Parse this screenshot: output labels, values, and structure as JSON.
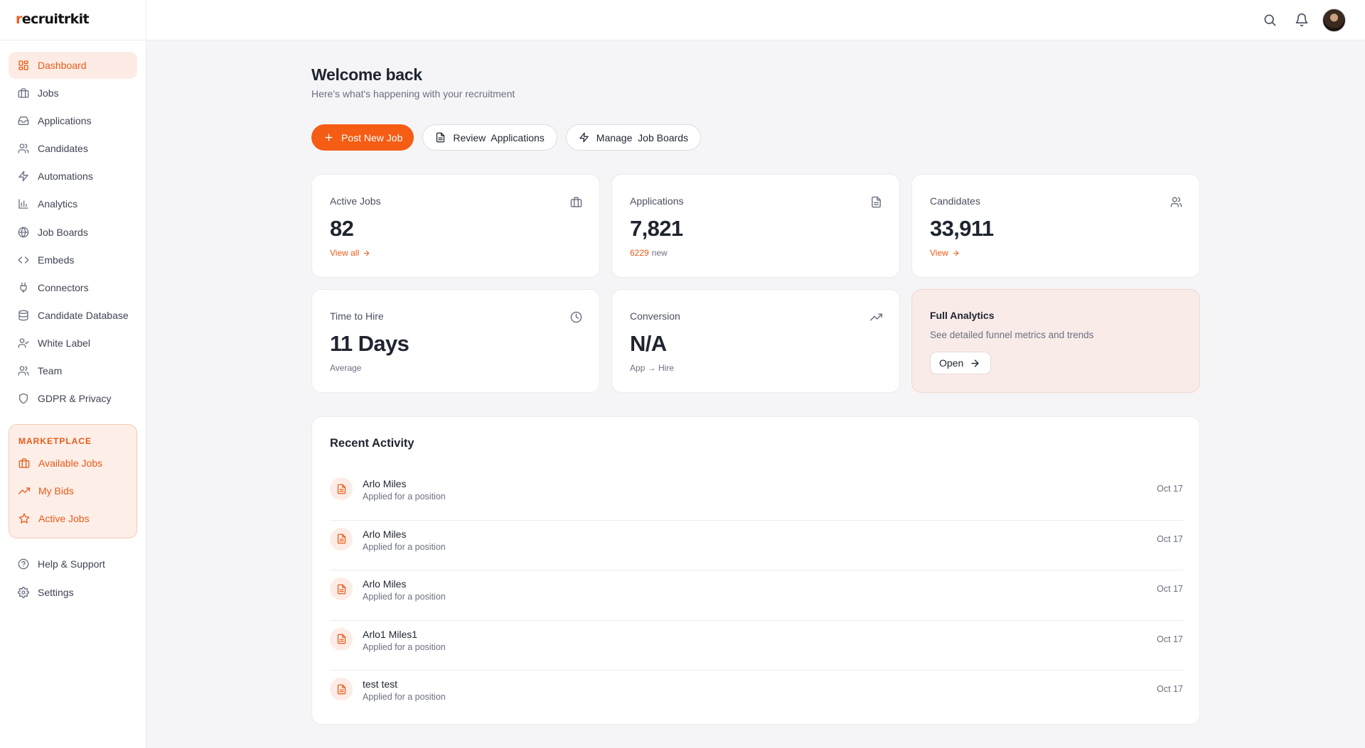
{
  "brand": {
    "logo_mark": "r",
    "logo_rest": "ecruitrkit"
  },
  "sidebar": {
    "items": [
      {
        "label": "Dashboard",
        "icon": "dashboard-icon",
        "active": true
      },
      {
        "label": "Jobs",
        "icon": "briefcase-icon"
      },
      {
        "label": "Applications",
        "icon": "inbox-icon"
      },
      {
        "label": "Candidates",
        "icon": "users-icon"
      },
      {
        "label": "Automations",
        "icon": "lightning-icon"
      },
      {
        "label": "Analytics",
        "icon": "bar-chart-icon"
      },
      {
        "label": "Job Boards",
        "icon": "globe-icon"
      },
      {
        "label": "Embeds",
        "icon": "code-icon"
      },
      {
        "label": "Connectors",
        "icon": "plug-icon"
      },
      {
        "label": "Candidate Database",
        "icon": "database-icon"
      },
      {
        "label": "White Label",
        "icon": "user-check-icon"
      },
      {
        "label": "Team",
        "icon": "team-icon"
      },
      {
        "label": "GDPR & Privacy",
        "icon": "shield-icon"
      }
    ],
    "marketplace": {
      "title": "MARKETPLACE",
      "items": [
        {
          "label": "Available Jobs",
          "icon": "briefcase-icon"
        },
        {
          "label": "My Bids",
          "icon": "trending-up-icon"
        },
        {
          "label": "Active Jobs",
          "icon": "star-icon"
        }
      ]
    },
    "bottom": [
      {
        "label": "Help & Support",
        "icon": "help-circle-icon"
      },
      {
        "label": "Settings",
        "icon": "gear-icon"
      }
    ]
  },
  "header": {
    "title": "Welcome back",
    "subtitle": "Here's what's happening with your recruitment"
  },
  "actions": {
    "post_job": "Post New Job",
    "review_applications": "Review  Applications",
    "manage_job_boards": "Manage  Job Boards"
  },
  "stats": {
    "active_jobs": {
      "label": "Active Jobs",
      "value": "82",
      "link": "View all"
    },
    "applications": {
      "label": "Applications",
      "value": "7,821",
      "new_count": "6229",
      "new_label": "new"
    },
    "candidates": {
      "label": "Candidates",
      "value": "33,911",
      "link": "View"
    },
    "time_to_hire": {
      "label": "Time to Hire",
      "value": "11 Days",
      "foot": "Average"
    },
    "conversion": {
      "label": "Conversion",
      "value": "N/A",
      "foot": "App → Hire"
    },
    "full_analytics": {
      "title": "Full Analytics",
      "subtitle": "See detailed funnel metrics and trends",
      "button": "Open"
    }
  },
  "activity": {
    "title": "Recent Activity",
    "rows": [
      {
        "name": "Arlo Miles",
        "desc": "Applied for a position",
        "date": "Oct 17"
      },
      {
        "name": "Arlo Miles",
        "desc": "Applied for a position",
        "date": "Oct 17"
      },
      {
        "name": "Arlo Miles",
        "desc": "Applied for a position",
        "date": "Oct 17"
      },
      {
        "name": "Arlo1 Miles1",
        "desc": "Applied for a position",
        "date": "Oct 17"
      },
      {
        "name": "test test",
        "desc": "Applied for a position",
        "date": "Oct 17"
      }
    ]
  },
  "colors": {
    "accent": "#f55c14",
    "accent_soft": "#fdece5",
    "background": "#f5f5f7"
  }
}
